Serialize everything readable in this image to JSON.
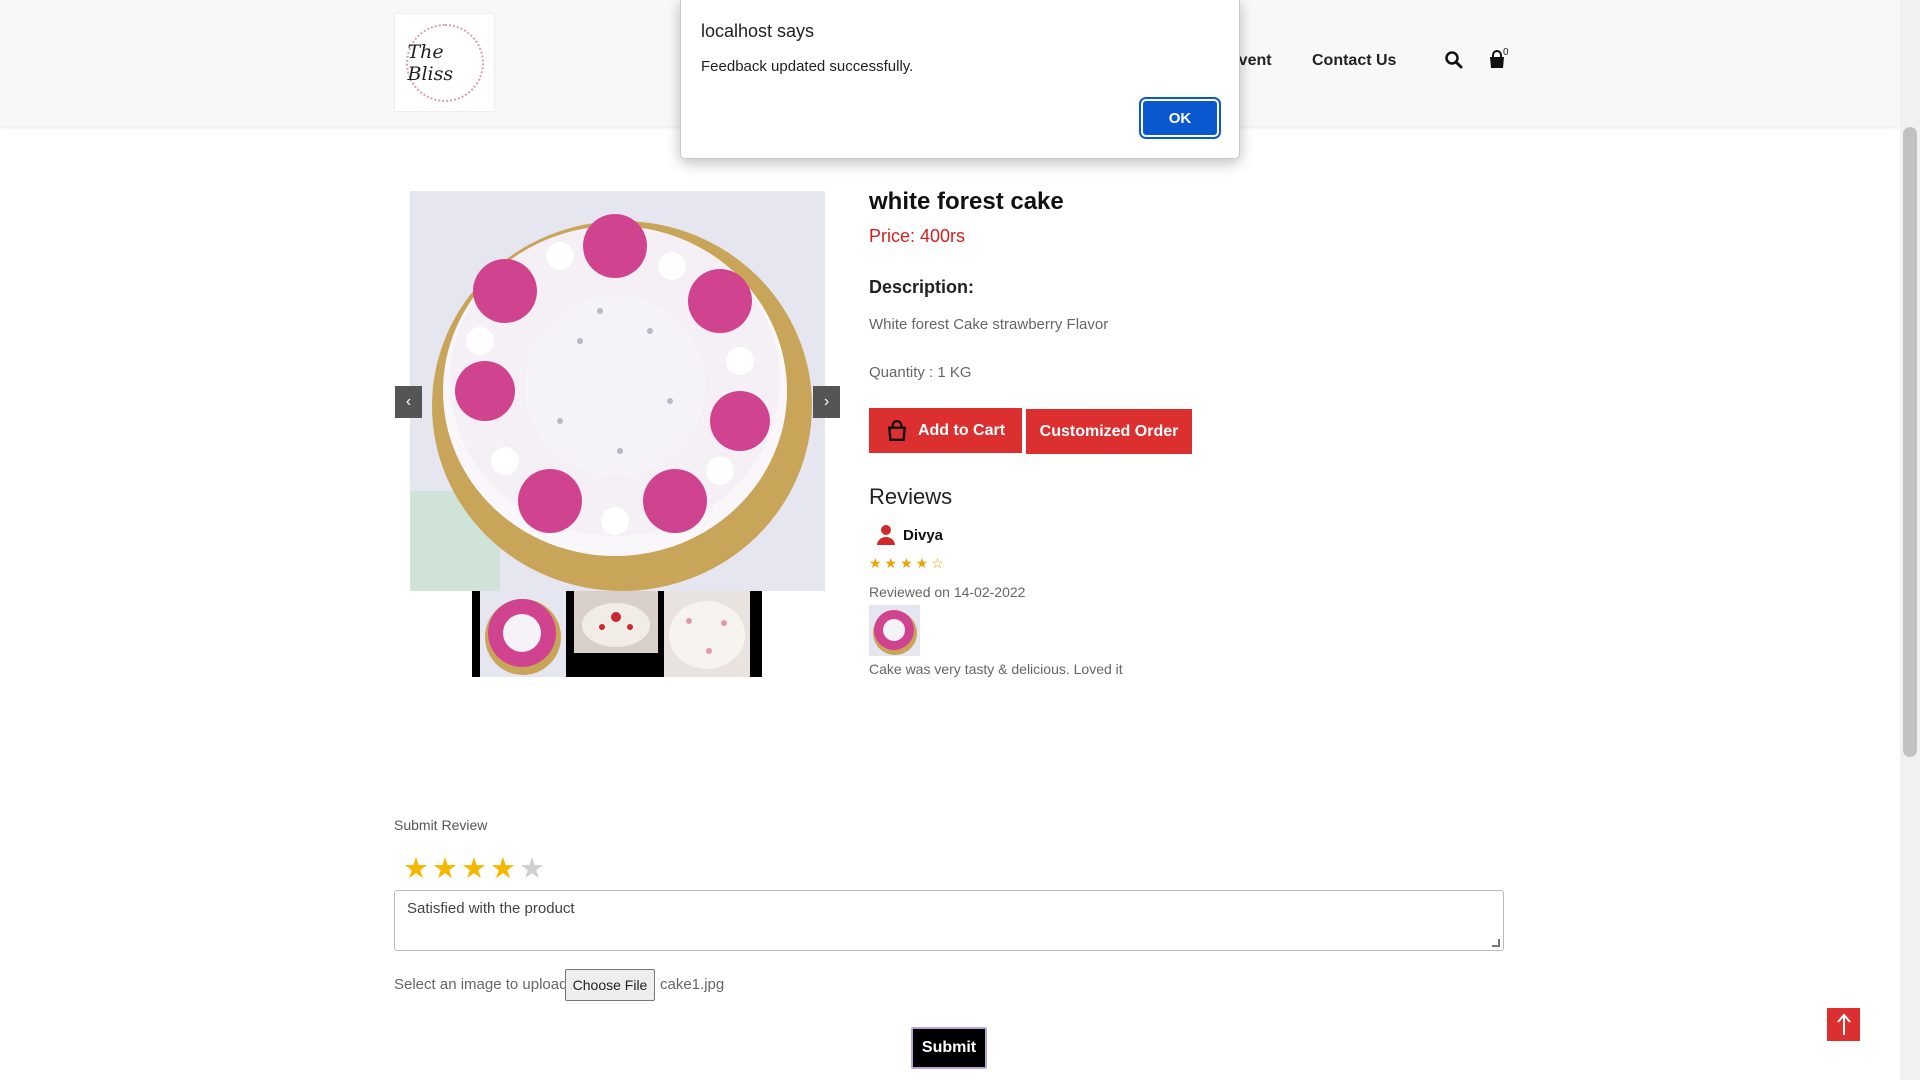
{
  "dialog": {
    "title": "localhost says",
    "message": "Feedback updated successfully.",
    "ok_label": "OK"
  },
  "header": {
    "logo_text": "The Bliss",
    "nav": {
      "event": "Event",
      "contact": "Contact Us"
    },
    "cart_count": "0"
  },
  "gallery": {
    "prev_label": "‹",
    "next_label": "›"
  },
  "product": {
    "title": "white forest cake",
    "price": "Price: 400rs",
    "description_label": "Description:",
    "description": "White forest Cake strawberry Flavor",
    "quantity": "Quantity : 1 KG",
    "add_to_cart_label": "Add to Cart",
    "customized_order_label": "Customized Order"
  },
  "reviews": {
    "heading": "Reviews",
    "items": [
      {
        "user": "Divya",
        "rating": 4,
        "stars_text": "★★★★☆",
        "date": "Reviewed on 14-02-2022",
        "comment": "Cake was very tasty & delicious. Loved it"
      }
    ]
  },
  "submit_review": {
    "label": "Submit Review",
    "rating": 4,
    "comment_value": "Satisfied with the product",
    "upload_label": "Select an image to upload",
    "choose_file_label": "Choose File",
    "file_name": "cake1.jpg",
    "submit_label": "Submit"
  },
  "icons": [
    "search-icon",
    "cart-icon",
    "user-icon",
    "bag-icon",
    "arrow-up-icon",
    "chevron-left-icon",
    "chevron-right-icon"
  ],
  "colors": {
    "accent_red": "#dc2f2f",
    "price_red": "#d11f1f",
    "star_gold": "#f5b800",
    "dialog_blue": "#0b57d0"
  }
}
